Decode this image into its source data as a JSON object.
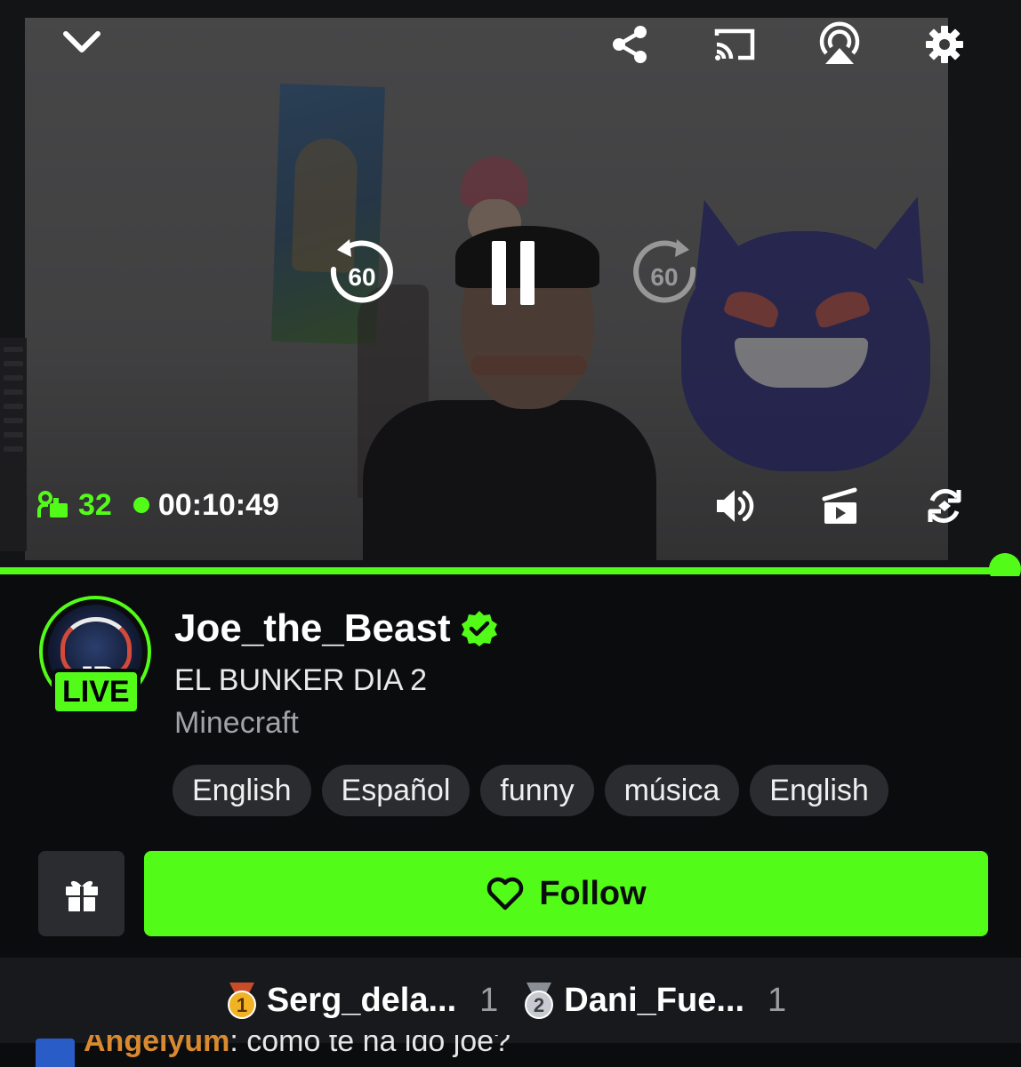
{
  "player": {
    "viewer_count": "32",
    "elapsed": "00:10:49",
    "rewind_seconds": "60",
    "forward_seconds": "60",
    "progress_percent": 100,
    "icons": [
      "chevron-down-icon",
      "share-icon",
      "cast-icon",
      "airplay-icon",
      "settings-icon",
      "rewind-60-icon",
      "pause-icon",
      "forward-60-icon",
      "volume-icon",
      "theater-mode-icon",
      "rotate-icon",
      "viewers-icon"
    ]
  },
  "channel": {
    "name": "Joe_the_Beast",
    "verified": true,
    "live_label": "LIVE",
    "avatar_initials": "JR",
    "stream_title": "EL BUNKER DIA 2",
    "category": "Minecraft",
    "tags": [
      "English",
      "Español",
      "funny",
      "música",
      "English"
    ]
  },
  "actions": {
    "follow_label": "Follow",
    "gift_icon": "gift-icon"
  },
  "leaderboard": [
    {
      "rank": "1",
      "name": "Serg_dela...",
      "count": "1"
    },
    {
      "rank": "2",
      "name": "Dani_Fue...",
      "count": "1"
    }
  ],
  "chat_preview": {
    "user": "Angelyum",
    "message": ": como te ha ido joe?"
  },
  "colors": {
    "accent": "#53fc18",
    "background": "#0b0c0e",
    "chip": "#2b2c30",
    "leaderboard_bg": "#18191c"
  }
}
